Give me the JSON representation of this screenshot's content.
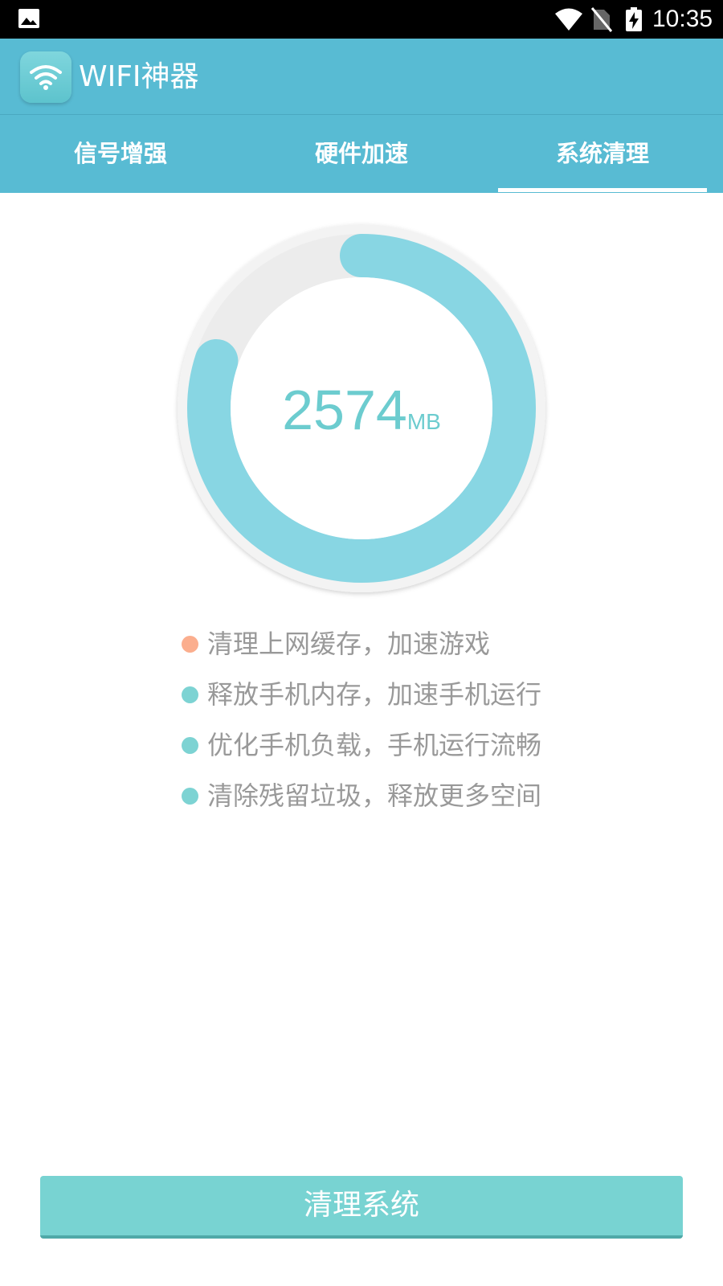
{
  "status_bar": {
    "time": "10:35",
    "icons": [
      "gallery-icon",
      "wifi-icon",
      "no-sim-icon",
      "battery-charging-icon"
    ]
  },
  "app_bar": {
    "title": "WIFI神器",
    "icon": "wifi-app-icon"
  },
  "tabs": [
    {
      "label": "信号增强",
      "selected": false
    },
    {
      "label": "硬件加速",
      "selected": false
    },
    {
      "label": "系统清理",
      "selected": true
    }
  ],
  "gauge": {
    "value": "2574",
    "unit": "MB",
    "fill_fraction": 0.8,
    "colors": {
      "track": "#ececec",
      "fill": "#88d6e3",
      "text": "#6ccccf"
    }
  },
  "features": [
    {
      "text": "清理上网缓存，加速游戏",
      "dot_color": "#fbae8e"
    },
    {
      "text": "释放手机内存，加速手机运行",
      "dot_color": "#7dd3d3"
    },
    {
      "text": "优化手机负载，手机运行流畅",
      "dot_color": "#7dd3d3"
    },
    {
      "text": "清除残留垃圾，释放更多空间",
      "dot_color": "#7dd3d3"
    }
  ],
  "action_button": {
    "label": "清理系统",
    "color": "#78d3d2"
  },
  "theme": {
    "primary": "#58bbd3"
  }
}
